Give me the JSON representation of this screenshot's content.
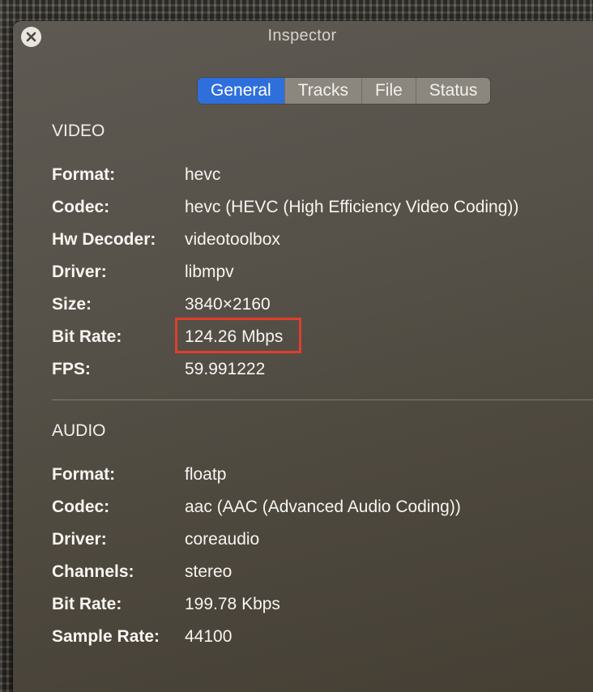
{
  "window": {
    "title": "Inspector"
  },
  "tabs": [
    {
      "label": "General",
      "active": true
    },
    {
      "label": "Tracks",
      "active": false
    },
    {
      "label": "File",
      "active": false
    },
    {
      "label": "Status",
      "active": false
    }
  ],
  "video": {
    "heading": "VIDEO",
    "rows": [
      {
        "label": "Format:",
        "value": "hevc"
      },
      {
        "label": "Codec:",
        "value": "hevc (HEVC (High Efficiency Video Coding))"
      },
      {
        "label": "Hw Decoder:",
        "value": "videotoolbox"
      },
      {
        "label": "Driver:",
        "value": "libmpv"
      },
      {
        "label": "Size:",
        "value": "3840×2160"
      },
      {
        "label": "Bit Rate:",
        "value": "124.26 Mbps"
      },
      {
        "label": "FPS:",
        "value": "59.991222"
      }
    ]
  },
  "audio": {
    "heading": "AUDIO",
    "rows": [
      {
        "label": "Format:",
        "value": "floatp"
      },
      {
        "label": "Codec:",
        "value": "aac (AAC (Advanced Audio Coding))"
      },
      {
        "label": "Driver:",
        "value": "coreaudio"
      },
      {
        "label": "Channels:",
        "value": "stereo"
      },
      {
        "label": "Bit Rate:",
        "value": "199.78 Kbps"
      },
      {
        "label": "Sample Rate:",
        "value": "44100"
      }
    ]
  },
  "colors": {
    "tab_active": "#2f6fdc",
    "highlight": "#e23d2c"
  },
  "icons": {
    "close": "close-icon"
  }
}
